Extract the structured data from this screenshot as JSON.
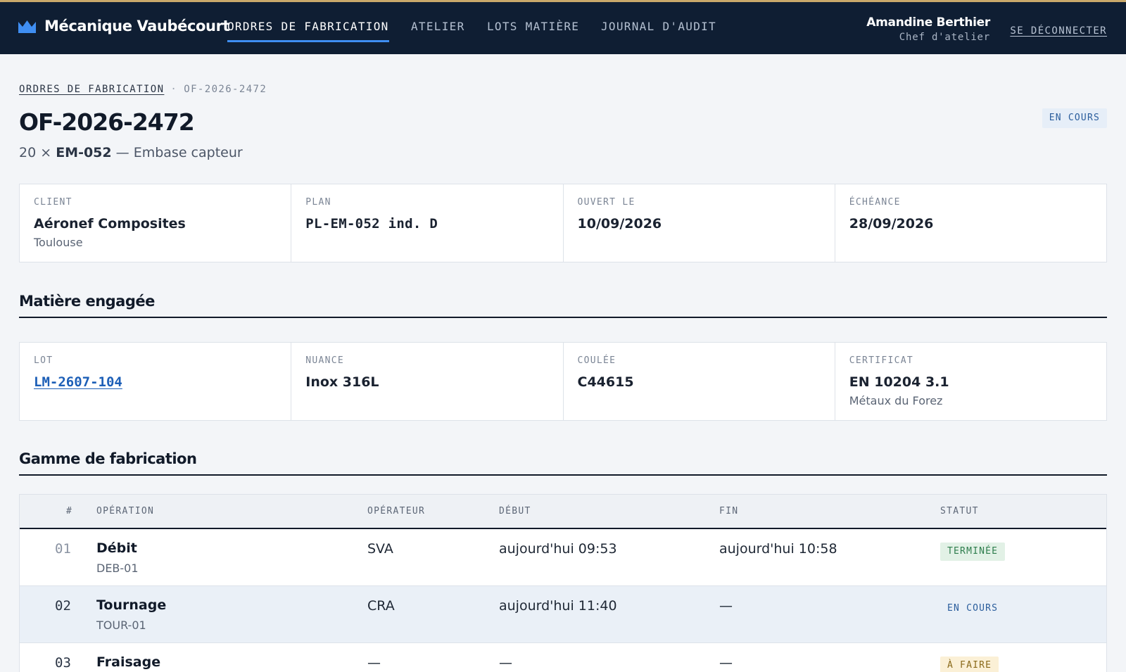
{
  "app": {
    "brand": "Mécanique Vaubécourt",
    "nav": [
      {
        "label": "ORDRES DE FABRICATION"
      },
      {
        "label": "ATELIER"
      },
      {
        "label": "LOTS MATIÈRE"
      },
      {
        "label": "JOURNAL D'AUDIT"
      }
    ],
    "user": {
      "name": "Amandine Berthier",
      "role": "Chef d'atelier"
    },
    "logout_label": "SE DÉCONNECTER"
  },
  "breadcrumb": {
    "root": "ORDRES DE FABRICATION",
    "separator": "·",
    "current": "OF-2026-2472"
  },
  "order": {
    "id": "OF-2026-2472",
    "quantity": "20 ×",
    "part": "EM-052",
    "description": "— Embase capteur",
    "status": "EN COURS"
  },
  "info": [
    {
      "label": "CLIENT",
      "value": "Aéronef Composites",
      "sub": "Toulouse"
    },
    {
      "label": "PLAN",
      "value": "PL-EM-052 ind. D",
      "sub": ""
    },
    {
      "label": "OUVERT LE",
      "value": "10/09/2026",
      "sub": ""
    },
    {
      "label": "ÉCHÉANCE",
      "value": "28/09/2026",
      "sub": ""
    }
  ],
  "material": {
    "title": "Matière engagée",
    "cells": [
      {
        "label": "LOT",
        "value": "LM-2607-104",
        "sub": ""
      },
      {
        "label": "NUANCE",
        "value": "Inox 316L",
        "sub": ""
      },
      {
        "label": "COULÉE",
        "value": "C44615",
        "sub": ""
      },
      {
        "label": "CERTIFICAT",
        "value": "EN 10204 3.1",
        "sub": "Métaux du Forez"
      }
    ]
  },
  "routing": {
    "title": "Gamme de fabrication",
    "headers": {
      "num": "#",
      "operation": "OPÉRATION",
      "operator": "OPÉRATEUR",
      "start": "DÉBUT",
      "end": "FIN",
      "status": "STATUT"
    },
    "rows": [
      {
        "num": "01",
        "operation": "Débit",
        "code": "DEB-01",
        "operator": "SVA",
        "start": "aujourd'hui 09:53",
        "end": "aujourd'hui 10:58",
        "status": "TERMINÉE"
      },
      {
        "num": "02",
        "operation": "Tournage",
        "code": "TOUR-01",
        "operator": "CRA",
        "start": "aujourd'hui 11:40",
        "end": "—",
        "status": "EN COURS"
      },
      {
        "num": "03",
        "operation": "Fraisage",
        "code": "",
        "operator": "—",
        "start": "—",
        "end": "—",
        "status": "À FAIRE"
      }
    ]
  },
  "colors": {
    "topbar": "#0f1e33",
    "accent": "#3f8ef2",
    "link": "#1d5fb7",
    "done": "#2e7d4d",
    "todo": "#8a6a1a"
  }
}
